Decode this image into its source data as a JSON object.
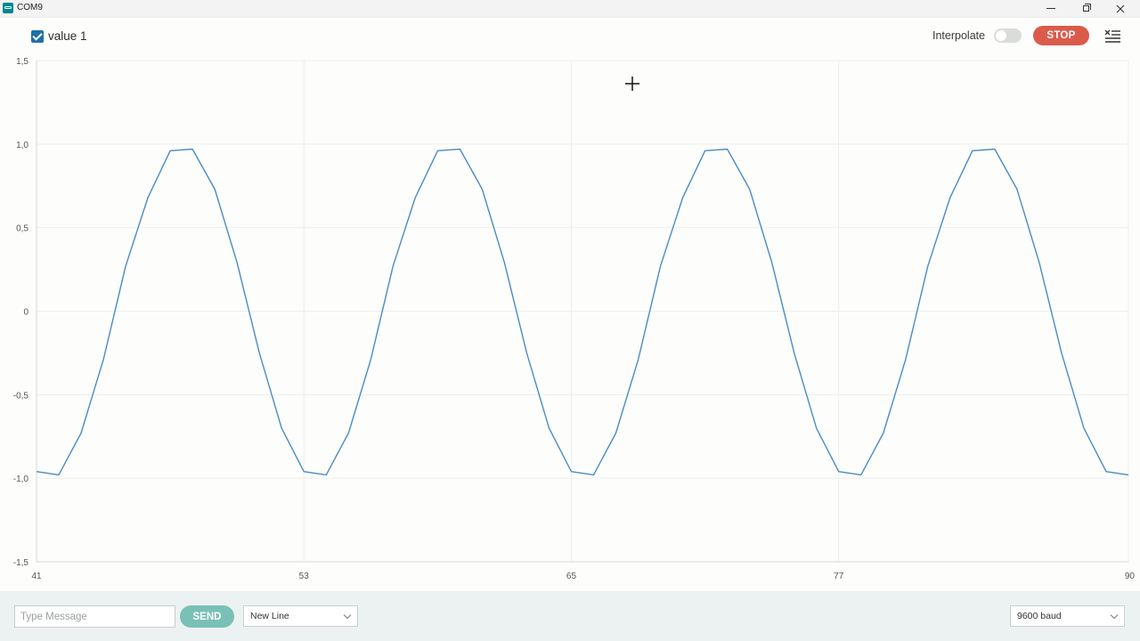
{
  "window": {
    "title": "COM9"
  },
  "legend": {
    "series_label": "value 1",
    "checked": true
  },
  "controls": {
    "interpolate_label": "Interpolate",
    "interpolate_on": false,
    "stop_label": "STOP"
  },
  "bottom": {
    "message_placeholder": "Type Message",
    "send_label": "SEND",
    "line_ending": "New Line",
    "baud": "9600 baud"
  },
  "colors": {
    "series": "#4a8cc2",
    "stop": "#da5b4a",
    "send": "#7ac0b6"
  },
  "chart_data": {
    "type": "line",
    "title": "",
    "xlabel": "",
    "ylabel": "",
    "xlim": [
      41,
      90
    ],
    "ylim": [
      -1.5,
      1.5
    ],
    "x_ticks": [
      41,
      53,
      65,
      77,
      90
    ],
    "y_ticks": [
      {
        "value": 1.5,
        "label": "1,5"
      },
      {
        "value": 1.0,
        "label": "1,0"
      },
      {
        "value": 0.5,
        "label": "0,5"
      },
      {
        "value": 0,
        "label": "0"
      },
      {
        "value": -0.5,
        "label": "-0,5"
      },
      {
        "value": -1.0,
        "label": "-1,0"
      },
      {
        "value": -1.5,
        "label": "-1,5"
      }
    ],
    "grid": true,
    "series": [
      {
        "name": "value 1",
        "x": [
          41,
          42,
          43,
          44,
          45,
          46,
          47,
          48,
          49,
          50,
          51,
          52,
          53,
          54,
          55,
          56,
          57,
          58,
          59,
          60,
          61,
          62,
          63,
          64,
          65,
          66,
          67,
          68,
          69,
          70,
          71,
          72,
          73,
          74,
          75,
          76,
          77,
          78,
          79,
          80,
          81,
          82,
          83,
          84,
          85,
          86,
          87,
          88,
          89,
          90
        ],
        "y": [
          -0.96,
          -0.98,
          -0.73,
          -0.29,
          0.27,
          0.68,
          0.96,
          0.97,
          0.73,
          0.29,
          -0.25,
          -0.7,
          -0.96,
          -0.98,
          -0.73,
          -0.29,
          0.27,
          0.68,
          0.96,
          0.97,
          0.73,
          0.29,
          -0.25,
          -0.7,
          -0.96,
          -0.98,
          -0.73,
          -0.29,
          0.27,
          0.68,
          0.96,
          0.97,
          0.73,
          0.29,
          -0.25,
          -0.7,
          -0.96,
          -0.98,
          -0.73,
          -0.29,
          0.27,
          0.68,
          0.96,
          0.97,
          0.73,
          0.29,
          -0.25,
          -0.7,
          -0.96,
          -0.98
        ]
      }
    ]
  }
}
